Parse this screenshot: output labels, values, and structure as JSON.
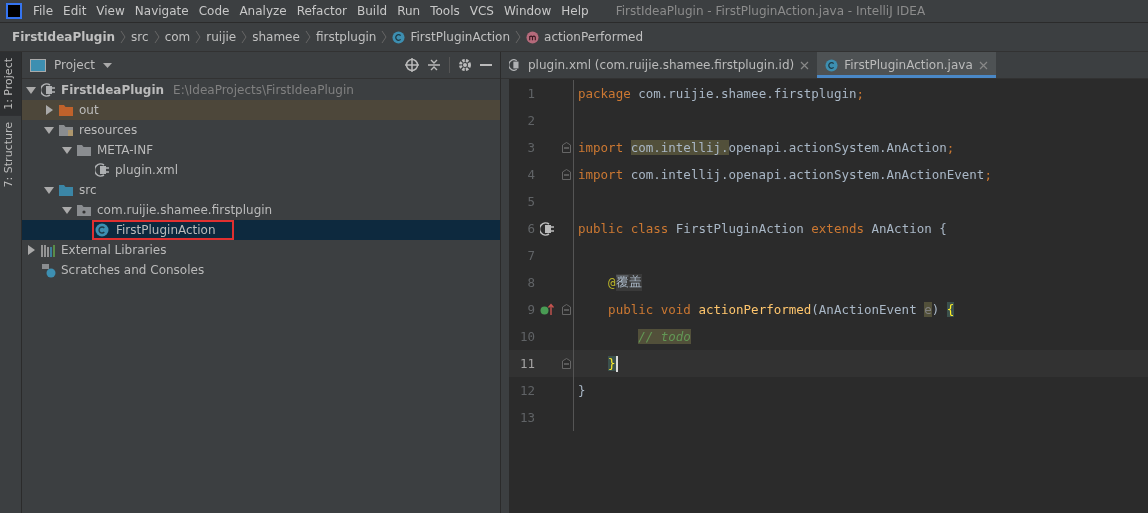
{
  "menu": [
    "File",
    "Edit",
    "View",
    "Navigate",
    "Code",
    "Analyze",
    "Refactor",
    "Build",
    "Run",
    "Tools",
    "VCS",
    "Window",
    "Help"
  ],
  "window": {
    "title": "FirstIdeaPlugin - FirstPluginAction.java - IntelliJ IDEA"
  },
  "breadcrumbs": [
    {
      "label": "FirstIdeaPlugin",
      "kind": "project"
    },
    {
      "label": "src",
      "kind": "dir"
    },
    {
      "label": "com",
      "kind": "dir"
    },
    {
      "label": "ruijie",
      "kind": "dir"
    },
    {
      "label": "shamee",
      "kind": "dir"
    },
    {
      "label": "firstplugin",
      "kind": "dir"
    },
    {
      "label": "FirstPluginAction",
      "kind": "class"
    },
    {
      "label": "actionPerformed",
      "kind": "method"
    }
  ],
  "side_tabs": [
    {
      "label": "1: Project",
      "selected": true
    },
    {
      "label": "7: Structure",
      "selected": false
    }
  ],
  "project_panel": {
    "title": "Project",
    "tree": [
      {
        "label": "FirstIdeaPlugin",
        "path": "E:\\IdeaProjects\\FirstIdeaPlugin",
        "kind": "module",
        "expanded": true,
        "selected": false,
        "children": [
          {
            "label": "out",
            "kind": "excluded",
            "expanded": false,
            "selected": false
          },
          {
            "label": "resources",
            "kind": "resources",
            "expanded": true,
            "selected": false,
            "children": [
              {
                "label": "META-INF",
                "kind": "folder",
                "expanded": true,
                "selected": false,
                "children": [
                  {
                    "label": "plugin.xml",
                    "kind": "plugin",
                    "selected": false
                  }
                ]
              }
            ]
          },
          {
            "label": "src",
            "kind": "source",
            "expanded": true,
            "selected": false,
            "children": [
              {
                "label": "com.ruijie.shamee.firstplugin",
                "kind": "package",
                "expanded": true,
                "selected": false,
                "children": [
                  {
                    "label": "FirstPluginAction",
                    "kind": "class",
                    "selected": true,
                    "annotated": true
                  }
                ]
              }
            ]
          }
        ]
      },
      {
        "label": "External Libraries",
        "kind": "libraries",
        "expanded": false,
        "selected": false
      },
      {
        "label": "Scratches and Consoles",
        "kind": "scratches",
        "selected": false
      }
    ]
  },
  "editor_tabs": [
    {
      "label": "plugin.xml (com.ruijie.shamee.firstplugin.id)",
      "kind": "plugin",
      "selected": false
    },
    {
      "label": "FirstPluginAction.java",
      "kind": "class",
      "selected": true
    }
  ],
  "code_lines": [
    {
      "number": "1",
      "current": false,
      "fold": false,
      "tokens": [
        {
          "text": "package ",
          "kind": "keyword"
        },
        {
          "text": "com.ruijie.shamee.firstplugin",
          "kind": "plain"
        },
        {
          "text": ";",
          "kind": "keyword"
        }
      ]
    },
    {
      "number": "2",
      "current": false,
      "fold": false
    },
    {
      "number": "3",
      "current": false,
      "fold": true,
      "tokens": [
        {
          "text": "import ",
          "kind": "keyword"
        },
        {
          "text": "com.intellij.",
          "kind": "highlight"
        },
        {
          "text": "openapi.actionSystem.AnAction",
          "kind": "plain"
        },
        {
          "text": ";",
          "kind": "keyword"
        }
      ]
    },
    {
      "number": "4",
      "current": false,
      "fold": true,
      "tokens": [
        {
          "text": "import ",
          "kind": "keyword"
        },
        {
          "text": "com.intellij.openapi.actionSystem.AnActionEvent",
          "kind": "plain"
        },
        {
          "text": ";",
          "kind": "keyword"
        }
      ]
    },
    {
      "number": "5",
      "current": false,
      "fold": false
    },
    {
      "number": "6",
      "current": false,
      "kind": "plugin",
      "fold": false,
      "tokens": [
        {
          "text": "public class ",
          "kind": "keyword"
        },
        {
          "text": "FirstPluginAction ",
          "kind": "plain"
        },
        {
          "text": "extends ",
          "kind": "keyword"
        },
        {
          "text": "AnAction {",
          "kind": "plain"
        }
      ]
    },
    {
      "number": "7",
      "current": false,
      "fold": false
    },
    {
      "number": "8",
      "current": false,
      "fold": false,
      "tokens": [
        {
          "text": "    @",
          "kind": "annotation"
        },
        {
          "text": "覆盖",
          "kind": "folded"
        }
      ]
    },
    {
      "number": "9",
      "current": false,
      "kind": "implements",
      "fold": true,
      "tokens": [
        {
          "text": "    public void ",
          "kind": "keyword"
        },
        {
          "text": "actionPerformed",
          "kind": "method"
        },
        {
          "text": "(AnActionEvent ",
          "kind": "plain"
        },
        {
          "text": "e",
          "kind": "unused"
        },
        {
          "text": ") ",
          "kind": "plain"
        },
        {
          "text": "{",
          "kind": "brace"
        }
      ]
    },
    {
      "number": "10",
      "current": false,
      "fold": false,
      "tokens": [
        {
          "text": "        // todo",
          "kind": "comment"
        }
      ]
    },
    {
      "number": "11",
      "current": true,
      "fold": true,
      "tokens": [
        {
          "text": "    }",
          "kind": "brace"
        }
      ]
    },
    {
      "number": "12",
      "current": false,
      "fold": false,
      "tokens": [
        {
          "text": "}",
          "kind": "plain"
        }
      ]
    },
    {
      "number": "13",
      "current": false,
      "fold": false
    }
  ]
}
